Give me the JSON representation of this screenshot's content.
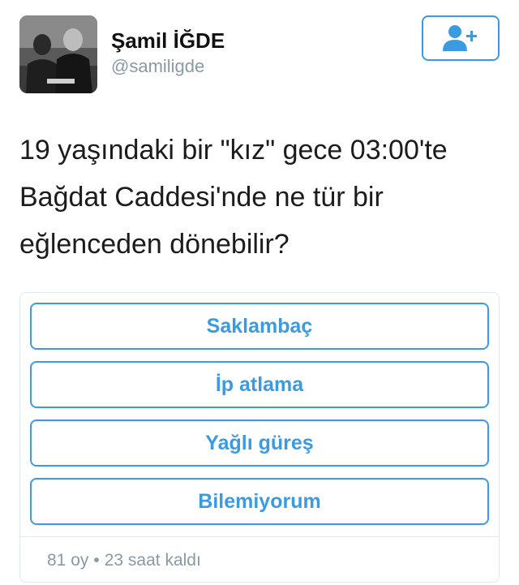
{
  "author": {
    "display_name": "Şamil İĞDE",
    "handle": "@samiligde",
    "avatar_description": "profile-photo"
  },
  "follow_button": {
    "icon": "add-user-icon"
  },
  "tweet": {
    "text": "19 yaşındaki bir \"kız\" gece 03:00'te\nBağdat Caddesi'nde ne tür bir\neğlenceden dönebilir?"
  },
  "poll": {
    "options": [
      {
        "label": "Saklambaç"
      },
      {
        "label": "İp atlama"
      },
      {
        "label": "Yağlı güreş"
      },
      {
        "label": "Bilemiyorum"
      }
    ],
    "votes": "81 oy",
    "separator": "•",
    "time_left": "23 saat kaldı"
  },
  "colors": {
    "accent": "#3b9be0",
    "muted_text": "#8899a6",
    "border": "#e1e8ed",
    "text": "#1c1c1c"
  }
}
